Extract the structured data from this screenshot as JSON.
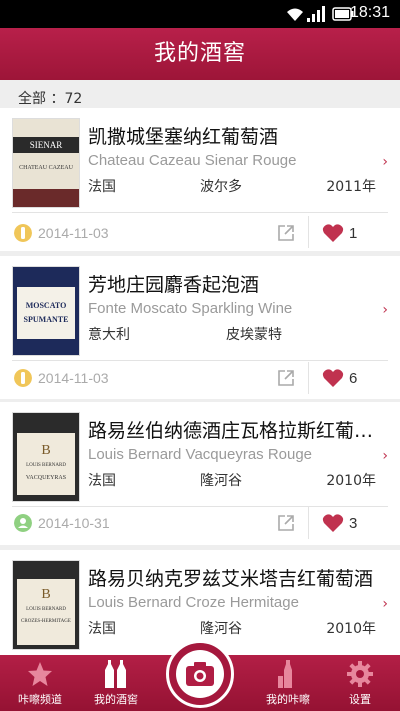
{
  "status_bar": {
    "time": "18:31"
  },
  "header": {
    "title": "我的酒窖"
  },
  "summary": {
    "count_label": "全部 ：72"
  },
  "wines": [
    {
      "name_zh": "凯撒城堡塞纳红葡萄酒",
      "name_en": "Chateau Cazeau Sienar Rouge",
      "country": "法国",
      "region": "波尔多",
      "year": "2011年",
      "date": "2014-11-03",
      "likes": "1",
      "label_text": "SIENAR",
      "label_sub": "CHATEAU CAZEAU"
    },
    {
      "name_zh": "芳地庄园麝香起泡酒",
      "name_en": "Fonte Moscato Sparkling Wine",
      "country": "意大利",
      "region": "皮埃蒙特",
      "year": "",
      "date": "2014-11-03",
      "likes": "6",
      "label_text": "MOSCATO",
      "label_sub": "SPUMANTE"
    },
    {
      "name_zh": "路易丝伯纳德酒庄瓦格拉斯红葡萄酒",
      "name_en": "Louis Bernard Vacqueyras Rouge",
      "country": "法国",
      "region": "隆河谷",
      "year": "2010年",
      "date": "2014-10-31",
      "likes": "3",
      "label_text": "VACQUEYRAS",
      "label_sub": "LOUIS BERNARD"
    },
    {
      "name_zh": "路易贝纳克罗兹艾米塔吉红葡萄酒",
      "name_en": "Louis Bernard Croze Hermitage",
      "country": "法国",
      "region": "隆河谷",
      "year": "2010年",
      "label_text": "CROZES-HERMITAGE",
      "label_sub": "LOUIS BERNARD"
    }
  ],
  "bottom_nav": {
    "channel": "咔嚓频道",
    "cellar": "我的酒窖",
    "my": "我的咔嚓",
    "settings": "设置"
  },
  "colors": {
    "brand": "#a51a40",
    "accent_date_1": "#f0c659",
    "accent_date_3": "#8fd081",
    "heart": "#c0324f"
  }
}
